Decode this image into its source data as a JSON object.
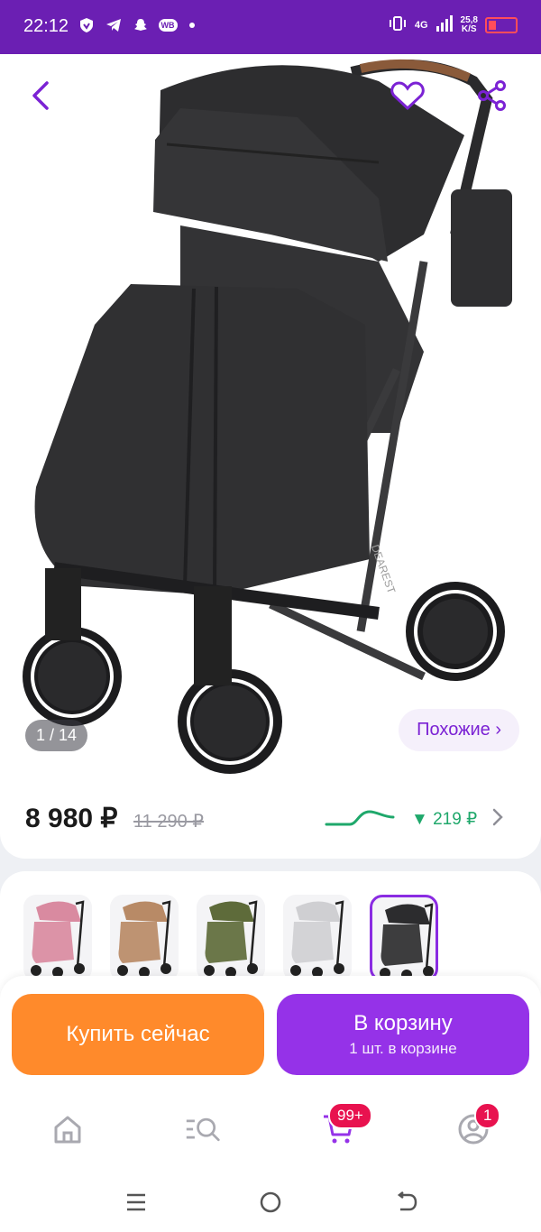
{
  "status_bar": {
    "time": "22:12",
    "network": "4G",
    "net_speed_value": "25,8",
    "net_speed_unit": "K/S",
    "wb_label": "WB",
    "battery_level": 0.3
  },
  "gallery": {
    "counter": "1 / 14",
    "similar_label": "Похожие ›",
    "brand_on_frame": "DEAREST"
  },
  "price": {
    "current": "8 980 ₽",
    "old": "11 290 ₽",
    "drop": "▼ 219 ₽"
  },
  "variants": [
    {
      "color": "pink",
      "hex": "#d98aa0"
    },
    {
      "color": "beige",
      "hex": "#b88a66"
    },
    {
      "color": "olive",
      "hex": "#5e6b3a"
    },
    {
      "color": "light-gray",
      "hex": "#cfcfd2"
    },
    {
      "color": "black",
      "hex": "#2c2c2e",
      "selected": true
    }
  ],
  "actions": {
    "buy_now": "Купить сейчас",
    "to_cart": "В корзину",
    "in_cart": "1 шт. в корзине"
  },
  "nav": {
    "cart_badge": "99+",
    "profile_badge": "1"
  },
  "colors": {
    "brand_purple": "#6b1fb3",
    "buy_orange": "#ff8a2b",
    "cart_purple": "#9532e8",
    "accent_purple": "#8a2be2",
    "badge_red": "#e8124f",
    "price_green": "#1fa86b"
  }
}
